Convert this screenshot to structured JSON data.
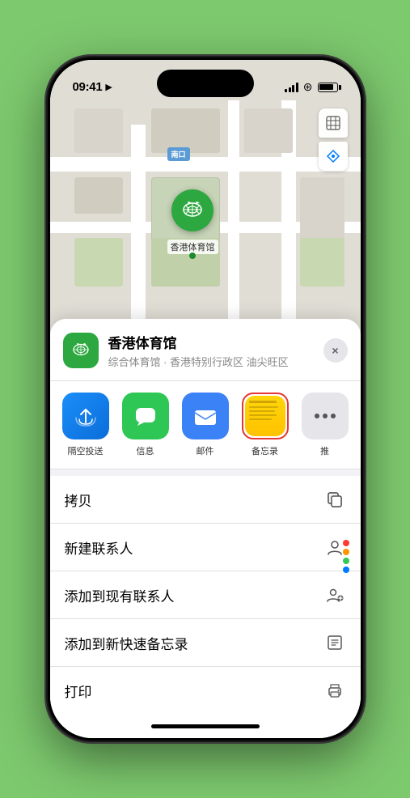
{
  "statusBar": {
    "time": "09:41",
    "locationArrow": "▶"
  },
  "map": {
    "exitLabel": "南口",
    "pinLabel": "香港体育馆"
  },
  "mapControls": {
    "mapTypeIcon": "🗺",
    "locationIcon": "➤"
  },
  "venueSheet": {
    "name": "香港体育馆",
    "description": "综合体育馆 · 香港特别行政区 油尖旺区",
    "closeLabel": "×"
  },
  "shareRow": {
    "items": [
      {
        "label": "隔空投送",
        "type": "airdrop"
      },
      {
        "label": "信息",
        "type": "messages"
      },
      {
        "label": "邮件",
        "type": "mail"
      },
      {
        "label": "备忘录",
        "type": "notes"
      },
      {
        "label": "推",
        "type": "more"
      }
    ]
  },
  "actionList": {
    "items": [
      {
        "label": "拷贝",
        "iconType": "copy"
      },
      {
        "label": "新建联系人",
        "iconType": "person"
      },
      {
        "label": "添加到现有联系人",
        "iconType": "person-add"
      },
      {
        "label": "添加到新快速备忘录",
        "iconType": "note"
      },
      {
        "label": "打印",
        "iconType": "print"
      }
    ]
  }
}
